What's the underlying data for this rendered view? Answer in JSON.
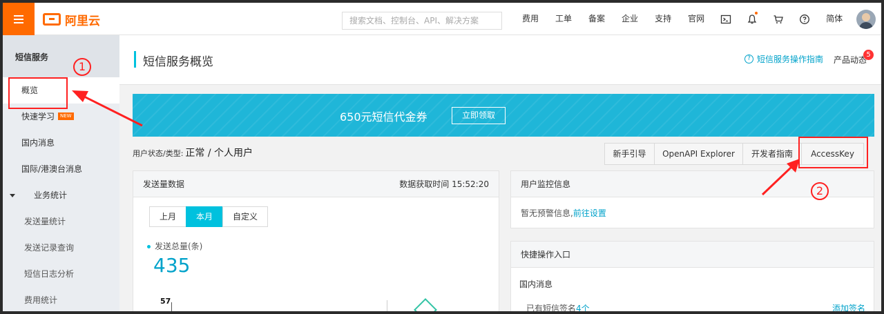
{
  "topbar": {
    "logo_text": "阿里云",
    "search_placeholder": "搜索文档、控制台、API、解决方案",
    "nav": [
      "费用",
      "工单",
      "备案",
      "企业",
      "支持",
      "官网"
    ],
    "icons": [
      "terminal-icon",
      "bell-icon",
      "cart-icon",
      "help-icon"
    ],
    "language": "简体"
  },
  "sidebar": {
    "title": "短信服务",
    "items": [
      {
        "label": "概览",
        "active": true
      },
      {
        "label": "快速学习",
        "badge": "NEW"
      },
      {
        "label": "国内消息"
      },
      {
        "label": "国际/港澳台消息"
      },
      {
        "label": "业务统计",
        "expanded": true
      }
    ],
    "sub_items": [
      "发送量统计",
      "发送记录查询",
      "短信日志分析",
      "费用统计"
    ]
  },
  "header": {
    "title": "短信服务概览",
    "help_link": "短信服务操作指南",
    "news": "产品动态",
    "news_count": "5"
  },
  "banner": {
    "text": "650元短信代金券",
    "button": "立即领取"
  },
  "user_status": {
    "label": "用户状态/类型:",
    "value": "正常 / 个人用户"
  },
  "buttons": [
    "新手引导",
    "OpenAPI Explorer",
    "开发者指南",
    "AccessKey"
  ],
  "send_panel": {
    "title": "发送量数据",
    "fetch_time": "数据获取时间 15:52:20",
    "tabs": [
      "上月",
      "本月",
      "自定义"
    ],
    "active_tab": "本月",
    "metric_label": "发送总量(条)",
    "metric_value": "435",
    "axis_max": "57"
  },
  "monitor_panel": {
    "title": "用户监控信息",
    "text": "暂无预警信息,",
    "link": "前往设置"
  },
  "quick_panel": {
    "title": "快捷操作入口",
    "section": "国内消息",
    "row_text": "已有短信签名",
    "row_count": "4个",
    "row_action": "添加签名"
  },
  "annotations": {
    "marker1": "1",
    "marker2": "2"
  },
  "colors": {
    "brand": "#ff6a00",
    "accent": "#00c1de",
    "annotation": "#ff2020"
  }
}
